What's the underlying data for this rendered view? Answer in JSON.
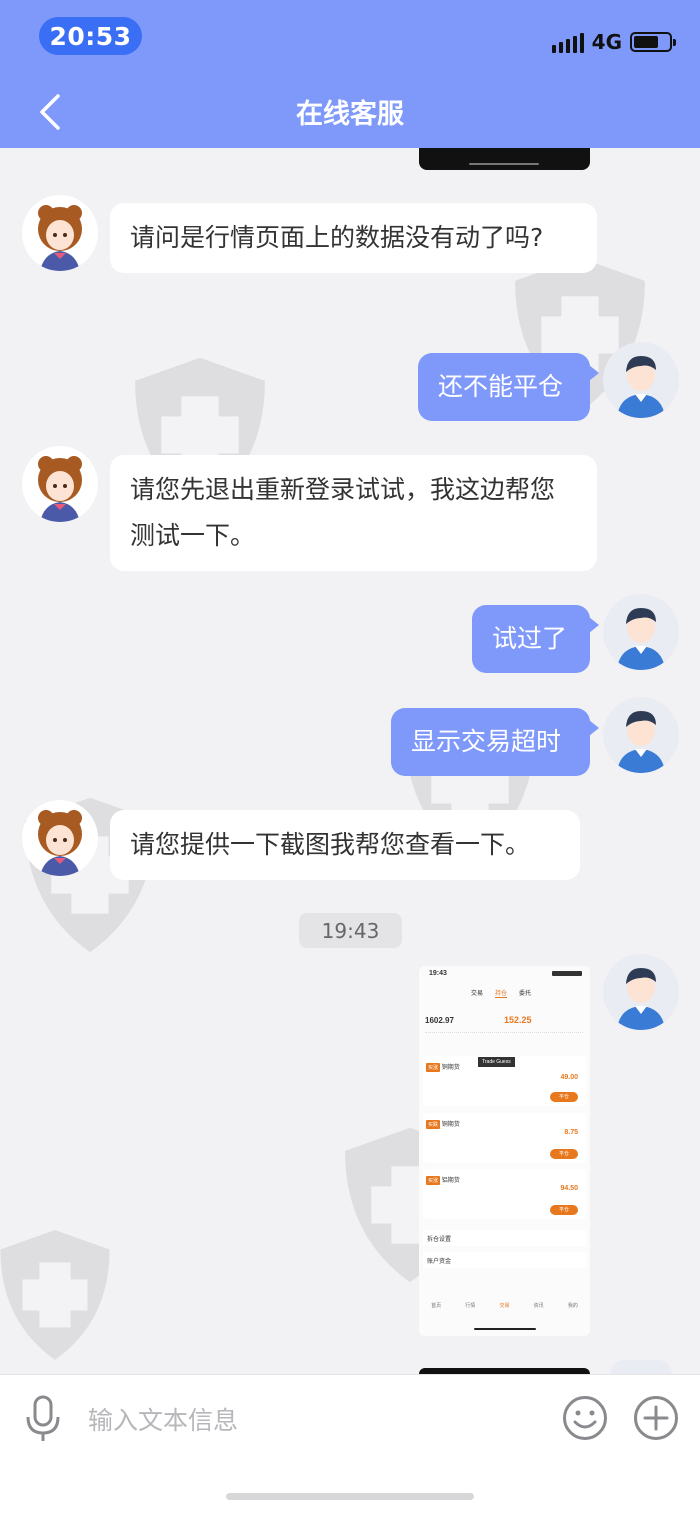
{
  "status_bar": {
    "time": "20:53",
    "network": "4G"
  },
  "header": {
    "title": "在线客服",
    "back_icon": "chevron-left-icon"
  },
  "messages": [
    {
      "side": "left",
      "text": "请问是行情页面上的数据没有动了吗?"
    },
    {
      "side": "right",
      "text": "还不能平仓"
    },
    {
      "side": "left",
      "text": "请您先退出重新登录试试，我这边帮您测试一下。"
    },
    {
      "side": "right",
      "text": "试过了"
    },
    {
      "side": "right",
      "text": "显示交易超时"
    },
    {
      "side": "left",
      "text": "请您提供一下截图我帮您查看一下。"
    }
  ],
  "timestamp": "19:43",
  "screenshot": {
    "time": "19:43",
    "tabs": [
      "交易",
      "持仓",
      "委托"
    ],
    "equity": "1602.97",
    "profit": "152.25",
    "tooltip": "Trade Guess",
    "positions": [
      {
        "tag": "买涨",
        "name": "铜期货",
        "value": "49.00"
      },
      {
        "tag": "买跌",
        "name": "铜期货",
        "value": "8.75"
      },
      {
        "tag": "买涨",
        "name": "铝期货",
        "value": "94.50"
      }
    ],
    "close_btn": "平仓",
    "menu_items": [
      "拆仓设置",
      "账户资金"
    ],
    "nav": [
      "首页",
      "行情",
      "交易",
      "资讯",
      "我的"
    ]
  },
  "input": {
    "placeholder": "输入文本信息"
  },
  "colors": {
    "accent": "#7f99fb",
    "time_pill": "#3a6ef5",
    "page_bg": "#f2f2f4"
  }
}
